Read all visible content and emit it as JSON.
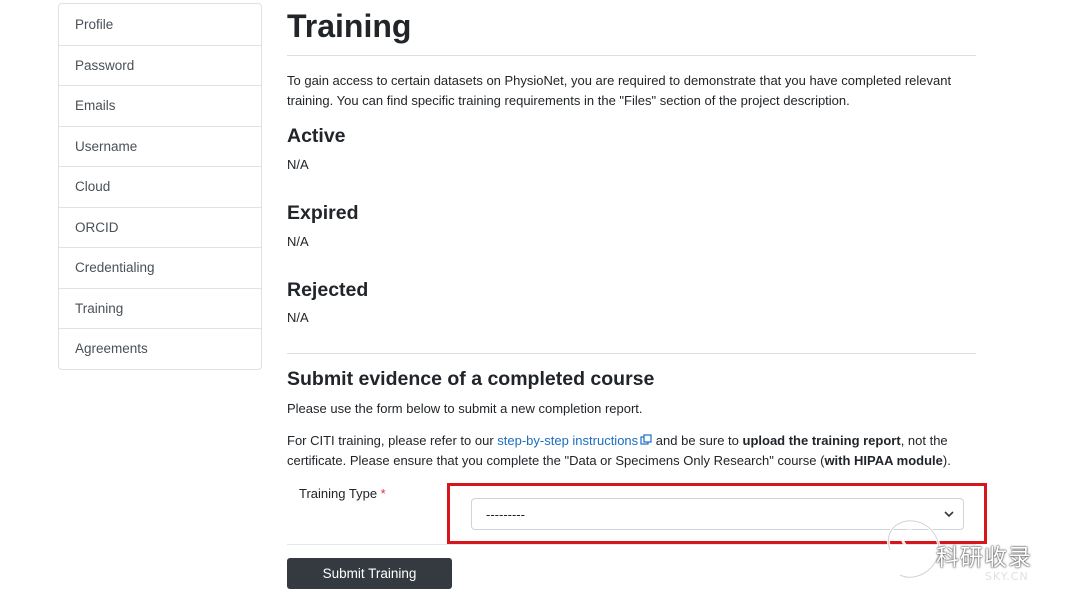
{
  "sidebar": {
    "items": [
      {
        "label": "Profile"
      },
      {
        "label": "Password"
      },
      {
        "label": "Emails"
      },
      {
        "label": "Username"
      },
      {
        "label": "Cloud"
      },
      {
        "label": "ORCID"
      },
      {
        "label": "Credentialing"
      },
      {
        "label": "Training"
      },
      {
        "label": "Agreements"
      }
    ]
  },
  "main": {
    "title": "Training",
    "intro": "To gain access to certain datasets on PhysioNet, you are required to demonstrate that you have completed relevant training. You can find specific training requirements in the \"Files\" section of the project description.",
    "sections": [
      {
        "heading": "Active",
        "value": "N/A"
      },
      {
        "heading": "Expired",
        "value": "N/A"
      },
      {
        "heading": "Rejected",
        "value": "N/A"
      }
    ],
    "submit": {
      "heading": "Submit evidence of a completed course",
      "intro": "Please use the form below to submit a new completion report.",
      "citi_prefix": "For CITI training, please refer to our ",
      "citi_link": "step-by-step instructions",
      "citi_middle": " and be sure to ",
      "citi_bold1": "upload the training report",
      "citi_after_bold1": ", not the certificate. Please ensure that you complete the \"Data or Specimens Only Research\" course (",
      "citi_bold2": "with HIPAA module",
      "citi_end": ").",
      "training_type_label": "Training Type",
      "required_mark": "*",
      "training_type_value": "---------",
      "button_label": "Submit Training"
    }
  },
  "watermark": {
    "text": "科研收录",
    "sub": "SKY.CN"
  },
  "colors": {
    "link": "#1a6dc0",
    "button_bg": "#343a40",
    "highlight": "#d6161b",
    "required": "#dc3545"
  },
  "icons": [
    "external-link-icon",
    "chevron-down-icon"
  ]
}
